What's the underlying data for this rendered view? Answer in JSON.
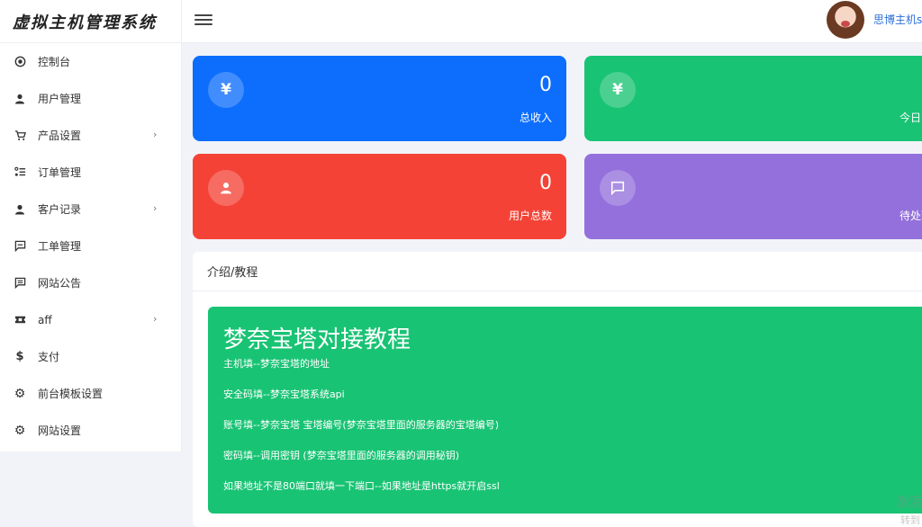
{
  "header": {
    "brand": "虚拟主机管理系统",
    "username": "思博主机s"
  },
  "sidebar": {
    "items": [
      {
        "label": "控制台",
        "icon": "dashboard-icon",
        "has_children": false
      },
      {
        "label": "用户管理",
        "icon": "user-icon",
        "has_children": false
      },
      {
        "label": "产品设置",
        "icon": "cart-icon",
        "has_children": true
      },
      {
        "label": "订单管理",
        "icon": "list-icon",
        "has_children": false
      },
      {
        "label": "客户记录",
        "icon": "user-icon",
        "has_children": true
      },
      {
        "label": "工单管理",
        "icon": "message-icon",
        "has_children": false
      },
      {
        "label": "网站公告",
        "icon": "message-lines-icon",
        "has_children": false
      },
      {
        "label": "aff",
        "icon": "ticket-icon",
        "has_children": true
      },
      {
        "label": "支付",
        "icon": "dollar-icon",
        "has_children": false
      },
      {
        "label": "前台模板设置",
        "icon": "gear-icon",
        "has_children": false
      },
      {
        "label": "网站设置",
        "icon": "gear-icon",
        "has_children": false
      }
    ]
  },
  "stats": {
    "total_income": {
      "value": "0",
      "label": "总收入",
      "icon": "yen-icon",
      "color": "#0d6efd"
    },
    "today_income": {
      "value": "",
      "label": "今日收",
      "icon": "yen-icon",
      "color": "#19c374"
    },
    "total_users": {
      "value": "0",
      "label": "用户总数",
      "icon": "user-icon",
      "color": "#f44336"
    },
    "pending": {
      "value": "",
      "label": "待处理工",
      "icon": "message-icon",
      "color": "#9370db"
    }
  },
  "intro": {
    "title": "介绍/教程",
    "heading": "梦奈宝塔对接教程",
    "lines": [
      "主机填--梦奈宝塔的地址",
      "安全码填--梦奈宝塔系统api",
      "账号填--梦奈宝塔 宝塔编号(梦奈宝塔里面的服务器的宝塔编号)",
      "密码填--调用密钥 (梦奈宝塔里面的服务器的调用秘钥)",
      "如果地址不是80端口就填一下端口--如果地址是https就开启ssl"
    ]
  },
  "watermark": {
    "line1": "激活",
    "line2": "转到"
  }
}
